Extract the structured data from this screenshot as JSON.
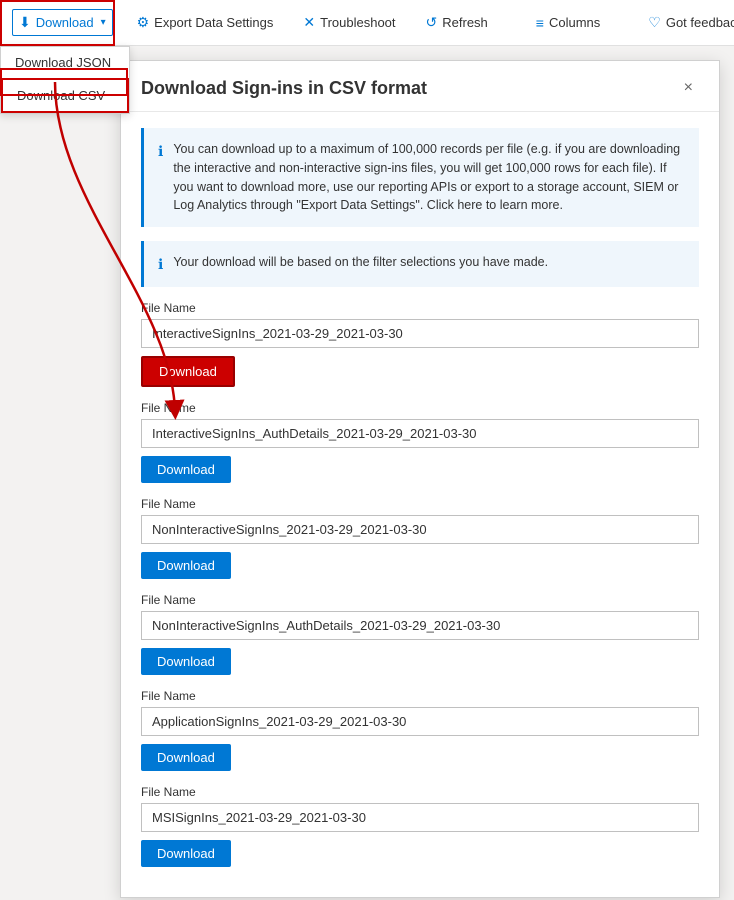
{
  "toolbar": {
    "download_label": "Download",
    "download_chevron": "▾",
    "export_data_label": "Export Data Settings",
    "troubleshoot_label": "Troubleshoot",
    "refresh_label": "Refresh",
    "columns_label": "Columns",
    "feedback_label": "Got feedback?"
  },
  "dropdown": {
    "json_label": "Download JSON",
    "csv_label": "Download CSV"
  },
  "modal": {
    "title": "Download Sign-ins in CSV format",
    "close_label": "×",
    "info1": "You can download up to a maximum of 100,000 records per file (e.g. if you are downloading the interactive and non-interactive sign-ins files, you will get 100,000 rows for each file). If you want to download more, use our reporting APIs or export to a storage account, SIEM or Log Analytics through \"Export Data Settings\". Click here to learn more.",
    "info2": "Your download will be based on the filter selections you have made.",
    "files": [
      {
        "label": "File Name",
        "value": "InteractiveSignIns_2021-03-29_2021-03-30",
        "btn_label": "Download",
        "first": true
      },
      {
        "label": "File Name",
        "value": "InteractiveSignIns_AuthDetails_2021-03-29_2021-03-30",
        "btn_label": "Download",
        "first": false
      },
      {
        "label": "File Name",
        "value": "NonInteractiveSignIns_2021-03-29_2021-03-30",
        "btn_label": "Download",
        "first": false
      },
      {
        "label": "File Name",
        "value": "NonInteractiveSignIns_AuthDetails_2021-03-29_2021-03-30",
        "btn_label": "Download",
        "first": false
      },
      {
        "label": "File Name",
        "value": "ApplicationSignIns_2021-03-29_2021-03-30",
        "btn_label": "Download",
        "first": false
      },
      {
        "label": "File Name",
        "value": "MSISignIns_2021-03-29_2021-03-30",
        "btn_label": "Download",
        "first": false
      }
    ]
  },
  "colors": {
    "accent": "#0078d4",
    "red": "#c00000",
    "border": "#d0d0d0"
  }
}
